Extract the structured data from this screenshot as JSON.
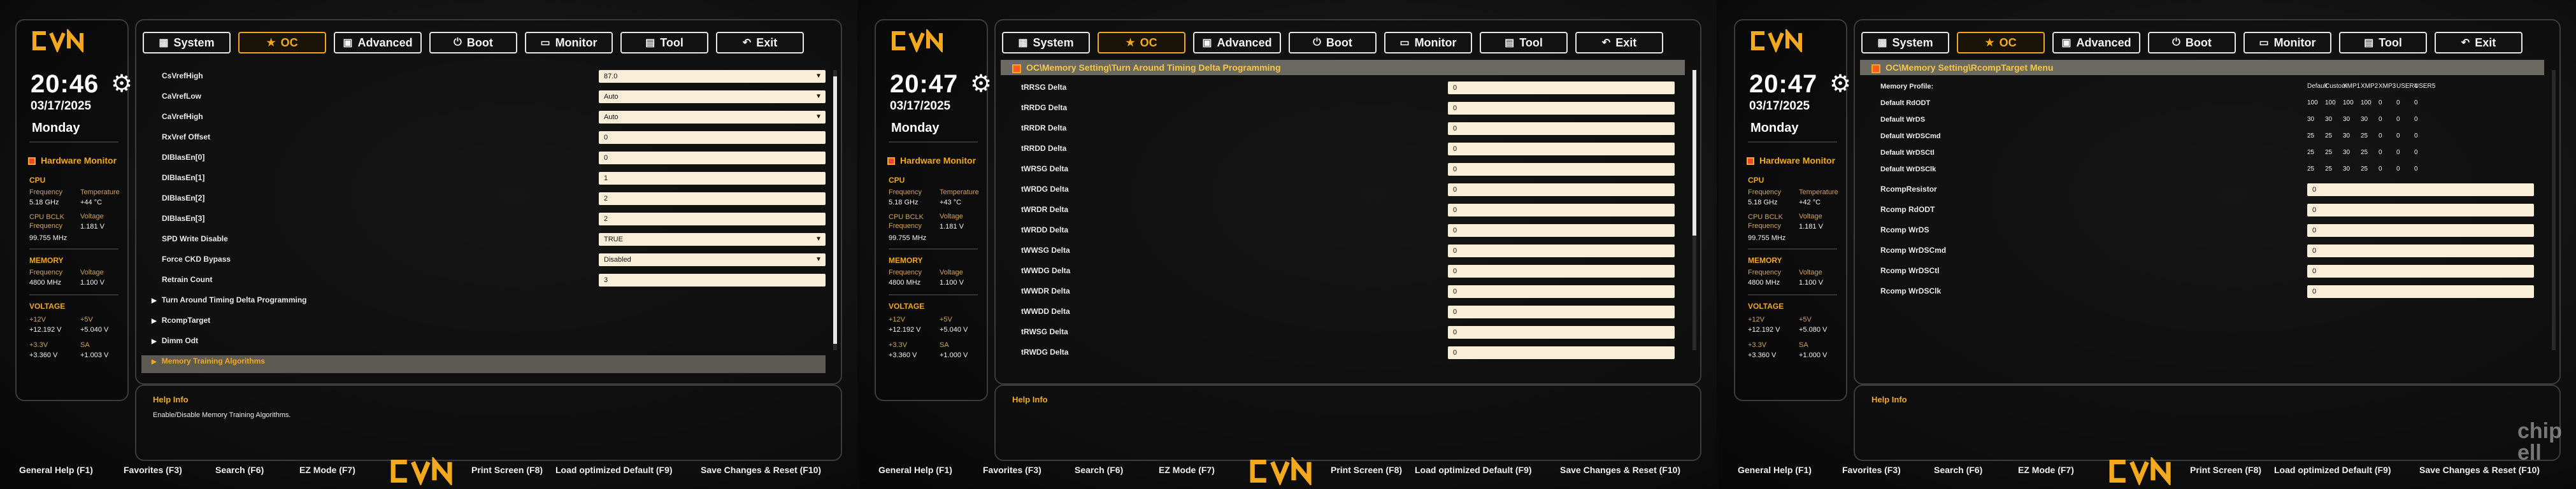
{
  "colors": {
    "accent": "#f2a91e",
    "field": "#f9eed7",
    "panel_border": "#3c3c3c"
  },
  "brand": "CVN",
  "tabs": [
    {
      "label": "System",
      "icon": "grid-icon"
    },
    {
      "label": "OC",
      "icon": "rocket-icon"
    },
    {
      "label": "Advanced",
      "icon": "chip-icon"
    },
    {
      "label": "Boot",
      "icon": "power-icon"
    },
    {
      "label": "Monitor",
      "icon": "monitor-icon"
    },
    {
      "label": "Tool",
      "icon": "toolbox-icon"
    },
    {
      "label": "Exit",
      "icon": "exit-arrow-icon"
    }
  ],
  "footer": {
    "general_help": "General Help (F1)",
    "favorites": "Favorites (F3)",
    "search": "Search (F6)",
    "ez_mode": "EZ Mode (F7)",
    "print_screen": "Print Screen (F8)",
    "load_optimized": "Load optimized Default (F9)",
    "save_reset": "Save Changes & Reset (F10)"
  },
  "help_title": "Help Info",
  "hw": {
    "title": "Hardware Monitor",
    "cpu": "CPU",
    "memory": "MEMORY",
    "voltage": "VOLTAGE",
    "frequency": "Frequency",
    "temperature": "Temperature",
    "bclk": "CPU BCLK Frequency",
    "voltage_lbl": "Voltage",
    "mem_freq_val": "4800 MHz",
    "mem_volt_val": "1.100 V",
    "bclk_val": "99.755 MHz",
    "vcore": "1.181 V",
    "v12": "+12V",
    "v5": "+5V",
    "v33": "+3.3V",
    "sa": "SA"
  },
  "screens": [
    {
      "time": "20:46",
      "date": "03/17/2025",
      "day": "Monday",
      "cpu_freq": "5.18 GHz",
      "cpu_temp": "+44 °C",
      "v12_val": "+12.192 V",
      "v5_val": "+5.040 V",
      "v33_val": "+3.360 V",
      "sa_val": "+1.003 V",
      "items": [
        {
          "label": "CsVrefHigh",
          "value": "87.0",
          "dd": true
        },
        {
          "label": "CaVrefLow",
          "value": "Auto",
          "dd": true
        },
        {
          "label": "CaVrefHigh",
          "value": "Auto",
          "dd": true
        },
        {
          "label": "RxVref Offset",
          "value": "0",
          "dd": false
        },
        {
          "label": "DIBIasEn[0]",
          "value": "0",
          "dd": false
        },
        {
          "label": "DIBIasEn[1]",
          "value": "1",
          "dd": false
        },
        {
          "label": "DIBIasEn[2]",
          "value": "2",
          "dd": false
        },
        {
          "label": "DIBIasEn[3]",
          "value": "2",
          "dd": false
        },
        {
          "label": "SPD Write Disable",
          "value": "TRUE",
          "dd": true
        },
        {
          "label": "Force CKD Bypass",
          "value": "Disabled",
          "dd": true
        },
        {
          "label": "Retrain Count",
          "value": "3",
          "dd": false
        }
      ],
      "submenus": [
        "Turn Around Timing Delta Programming",
        "RcompTarget",
        "Dimm Odt",
        "Memory Training Algorithms"
      ],
      "help_text": "Enable/Disable Memory Training Algorithms."
    },
    {
      "time": "20:47",
      "date": "03/17/2025",
      "day": "Monday",
      "cpu_freq": "5.18 GHz",
      "cpu_temp": "+43 °C",
      "v12_val": "+12.192 V",
      "v5_val": "+5.040 V",
      "v33_val": "+3.360 V",
      "sa_val": "+1.000 V",
      "crumb": "OC\\Memory Setting\\Turn Around Timing Delta Programming",
      "items": [
        {
          "label": "tRRSG Delta",
          "value": "0"
        },
        {
          "label": "tRRDG Delta",
          "value": "0"
        },
        {
          "label": "tRRDR Delta",
          "value": "0"
        },
        {
          "label": "tRRDD Delta",
          "value": "0"
        },
        {
          "label": "tWRSG Delta",
          "value": "0"
        },
        {
          "label": "tWRDG Delta",
          "value": "0"
        },
        {
          "label": "tWRDR Delta",
          "value": "0"
        },
        {
          "label": "tWRDD Delta",
          "value": "0"
        },
        {
          "label": "tWWSG Delta",
          "value": "0"
        },
        {
          "label": "tWWDG Delta",
          "value": "0"
        },
        {
          "label": "tWWDR Delta",
          "value": "0"
        },
        {
          "label": "tWWDD Delta",
          "value": "0"
        },
        {
          "label": "tRWSG Delta",
          "value": "0"
        },
        {
          "label": "tRWDG Delta",
          "value": "0"
        }
      ]
    },
    {
      "time": "20:47",
      "date": "03/17/2025",
      "day": "Monday",
      "cpu_freq": "5.18 GHz",
      "cpu_temp": "+42 °C",
      "v12_val": "+12.192 V",
      "v5_val": "+5.080 V",
      "v33_val": "+3.360 V",
      "sa_val": "+1.000 V",
      "crumb": "OC\\Memory Setting\\RcompTarget Menu",
      "profile_label": "Memory Profile:",
      "profiles": [
        "Default",
        "Custom",
        "XMP1",
        "XMP2",
        "XMP3",
        "USER4",
        "USER5"
      ],
      "table": [
        {
          "label": "Default RdODT",
          "vals": [
            "100",
            "100",
            "100",
            "100",
            "0",
            "0",
            "0"
          ]
        },
        {
          "label": "Default WrDS",
          "vals": [
            "30",
            "30",
            "30",
            "30",
            "0",
            "0",
            "0"
          ]
        },
        {
          "label": "Default WrDSCmd",
          "vals": [
            "25",
            "25",
            "30",
            "25",
            "0",
            "0",
            "0"
          ]
        },
        {
          "label": "Default WrDSCtl",
          "vals": [
            "25",
            "25",
            "30",
            "25",
            "0",
            "0",
            "0"
          ]
        },
        {
          "label": "Default WrDSClk",
          "vals": [
            "25",
            "25",
            "30",
            "25",
            "0",
            "0",
            "0"
          ]
        }
      ],
      "items": [
        {
          "label": "RcompResistor",
          "value": "0"
        },
        {
          "label": "Rcomp RdODT",
          "value": "0"
        },
        {
          "label": "Rcomp WrDS",
          "value": "0"
        },
        {
          "label": "Rcomp WrDSCmd",
          "value": "0"
        },
        {
          "label": "Rcomp WrDSCtl",
          "value": "0"
        },
        {
          "label": "Rcomp WrDSClk",
          "value": "0"
        }
      ]
    }
  ],
  "watermark": "chip ell"
}
